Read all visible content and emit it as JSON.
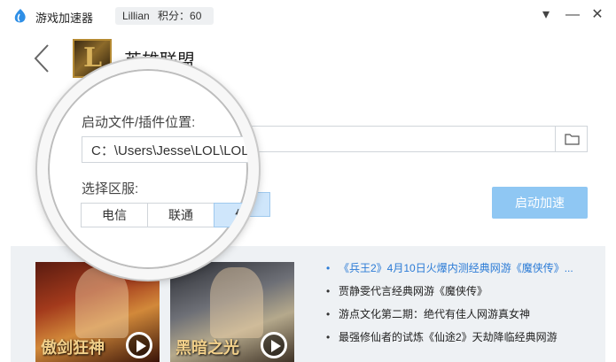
{
  "titlebar": {
    "app_name": "游戏加速器",
    "username": "Lillian",
    "points_label": "积分",
    "points_value": "60",
    "points_text": "积分：60",
    "controls": [
      "▾",
      "—",
      "✕"
    ]
  },
  "header": {
    "game_title": "英雄联盟",
    "game_icon": "lol-game-icon"
  },
  "form": {
    "path_label": "启动文件/插件位置:",
    "path_value": "C：\\Users\\Jesse\\LOL\\LOL.exe",
    "region_label": "选择区服:",
    "regions": [
      {
        "label": "电信",
        "selected": false
      },
      {
        "label": "联通",
        "selected": false
      },
      {
        "label": "体验",
        "selected": true
      }
    ],
    "start_button": "启动加速"
  },
  "news": {
    "items": [
      {
        "text": "《兵王2》4月10日火爆内测经典网游《魔侠传》...",
        "highlight": true
      },
      {
        "text": "贾静雯代言经典网游《魔侠传》",
        "highlight": false
      },
      {
        "text": "游点文化第二期：绝代有佳人网游真女神",
        "highlight": false
      },
      {
        "text": "最强修仙者的试炼《仙途2》天劫降临经典网游",
        "highlight": false
      }
    ],
    "thumbnails": [
      {
        "caption": "傲剑狂神",
        "icon": "play-icon"
      },
      {
        "caption": "黑暗之光",
        "icon": "play-icon"
      }
    ]
  },
  "colors": {
    "accent": "#8fc7f3",
    "link": "#2b7bd6",
    "selected_region": "#cfe6fb",
    "panel_bg": "#eef1f4"
  }
}
